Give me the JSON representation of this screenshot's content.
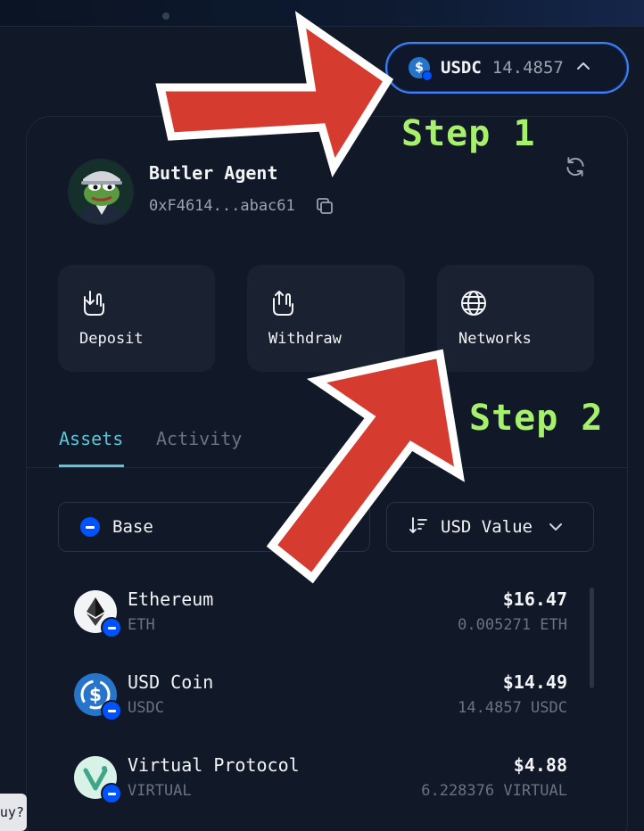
{
  "balance_pill": {
    "token_icon": "usdc-coin-icon",
    "symbol": "USDC",
    "amount": "14.4857",
    "chevron_icon": "chevron-up-icon"
  },
  "wallet": {
    "avatar_icon": "frog-agent-avatar",
    "name": "Butler Agent",
    "address": "0xF4614...abac61",
    "copy_icon": "copy-icon",
    "refresh_icon": "refresh-icon"
  },
  "actions": [
    {
      "label": "Deposit",
      "icon": "deposit-icon"
    },
    {
      "label": "Withdraw",
      "icon": "withdraw-icon"
    },
    {
      "label": "Networks",
      "icon": "globe-icon"
    }
  ],
  "tabs": [
    {
      "label": "Assets",
      "active": true
    },
    {
      "label": "Activity",
      "active": false
    }
  ],
  "filters": {
    "network": "Base",
    "sort": "USD Value"
  },
  "assets": [
    {
      "name": "Ethereum",
      "symbol": "ETH",
      "value": "$16.47",
      "quantity": "0.005271 ETH",
      "icon": "ethereum-icon"
    },
    {
      "name": "USD Coin",
      "symbol": "USDC",
      "value": "$14.49",
      "quantity": "14.4857 USDC",
      "icon": "usdc-icon"
    },
    {
      "name": "Virtual Protocol",
      "symbol": "VIRTUAL",
      "value": "$4.88",
      "quantity": "6.228376 VIRTUAL",
      "icon": "virtual-protocol-icon"
    }
  ],
  "side_tooltip": "uy?",
  "annotations": {
    "step1": "Step 1",
    "step2": "Step 2"
  },
  "colors": {
    "background": "#111827",
    "accent_teal": "#5ec5d6",
    "pill_border": "#3b82f6",
    "arrow_red": "#d63b2f",
    "step_green": "#a6f06c",
    "base_blue": "#0052ff",
    "usdc_blue": "#2775ca"
  }
}
